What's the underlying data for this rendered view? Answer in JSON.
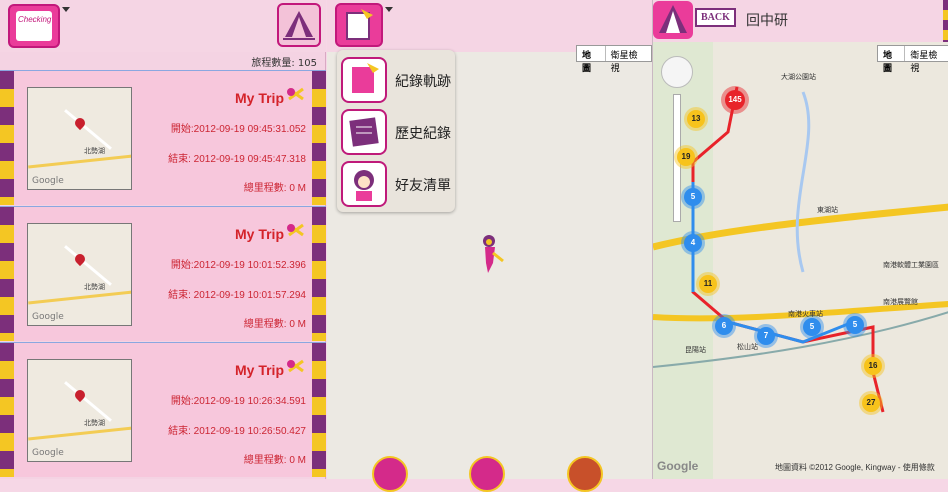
{
  "left": {
    "trip_count_label": "旅程數量: 105",
    "trips": [
      {
        "title": "My Trip",
        "start": "開始:2012-09-19 09:45:31.052",
        "end": "結束: 2012-09-19 09:45:47.318",
        "distance": "總里程數: 0 M",
        "map_place": "北勢湖",
        "map_brand": "Google"
      },
      {
        "title": "My Trip",
        "start": "開始:2012-09-19 10:01:52.396",
        "end": "結束: 2012-09-19 10:01:57.294",
        "distance": "總里程數: 0 M",
        "map_place": "北勢湖",
        "map_brand": "Google"
      },
      {
        "title": "My Trip",
        "start": "開始:2012-09-19 10:26:34.591",
        "end": "結束: 2012-09-19 10:26:50.427",
        "distance": "總里程數: 0 M",
        "map_place": "北勢湖",
        "map_brand": "Google"
      }
    ],
    "checkin_icon_text": "Checking"
  },
  "mid": {
    "menu": [
      {
        "label": "紀錄軌跡"
      },
      {
        "label": "歷史紀錄"
      },
      {
        "label": "好友清單"
      }
    ],
    "map_type": {
      "map": "地圖",
      "satellite": "衛星檢視"
    }
  },
  "right": {
    "back_label": "BACK",
    "header_title": "回中研",
    "map_type": {
      "map": "地圖",
      "satellite": "衛星檢視"
    },
    "map_footer": "地圖資料 ©2012 Google, Kingway - 使用條款",
    "google": "Google",
    "clusters": [
      {
        "label": "145",
        "color": "red"
      },
      {
        "label": "13",
        "color": "yellow"
      },
      {
        "label": "19",
        "color": "yellow"
      },
      {
        "label": "5",
        "color": "blue"
      },
      {
        "label": "4",
        "color": "blue"
      },
      {
        "label": "11",
        "color": "yellow"
      },
      {
        "label": "6",
        "color": "blue"
      },
      {
        "label": "7",
        "color": "blue"
      },
      {
        "label": "5",
        "color": "blue"
      },
      {
        "label": "5",
        "color": "blue"
      },
      {
        "label": "16",
        "color": "yellow"
      },
      {
        "label": "27",
        "color": "yellow"
      }
    ],
    "place_labels": [
      "大湖公園站",
      "東湖站",
      "南港軟體工業園區",
      "南港火車站",
      "南港展覽館",
      "昆陽站",
      "松山站"
    ]
  },
  "colors": {
    "accent": "#c2187b",
    "panel": "#f4d3e3",
    "trip_text": "#cc2533"
  }
}
